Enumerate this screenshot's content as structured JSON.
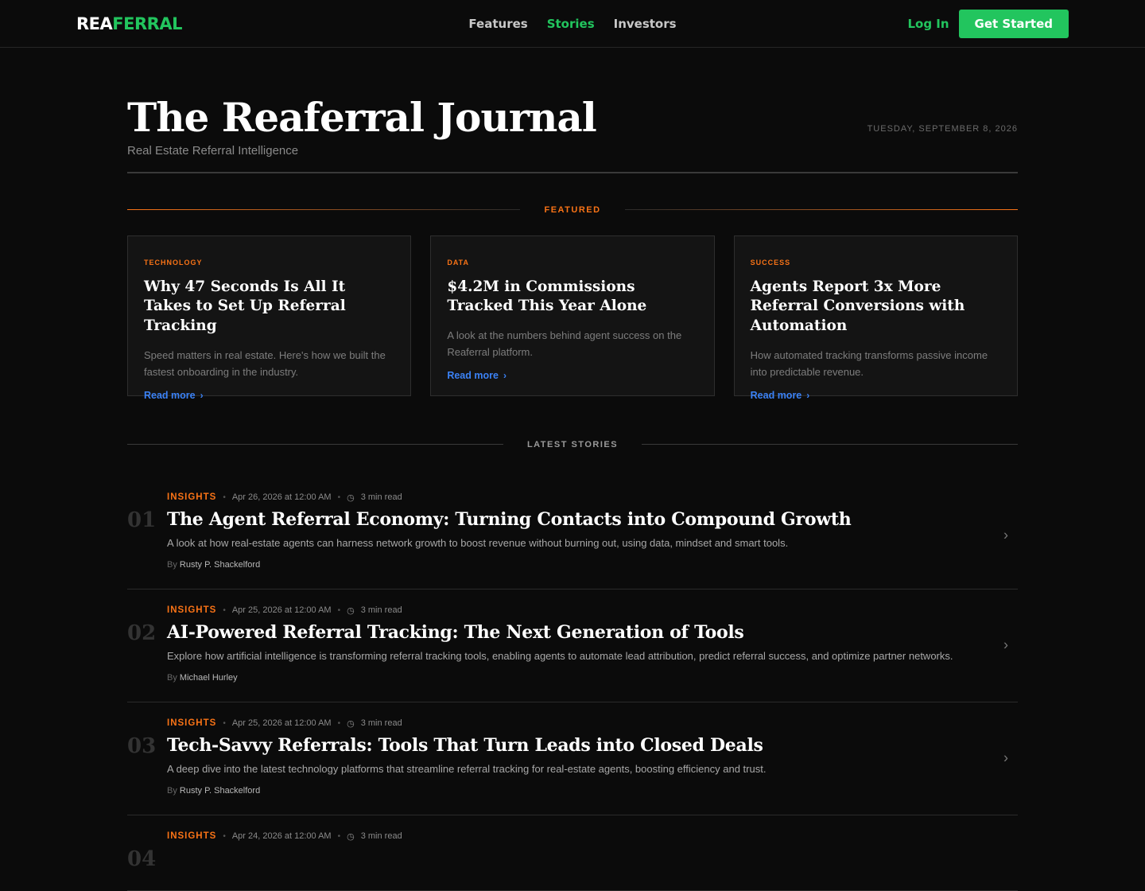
{
  "nav": {
    "logo_part1": "REA",
    "logo_part2": "FERRAL",
    "links": [
      "Features",
      "Stories",
      "Investors"
    ],
    "active_link": "Stories",
    "login": "Log In",
    "cta": "Get Started"
  },
  "masthead": {
    "title": "The Reaferral Journal",
    "subtitle": "Real Estate Referral Intelligence",
    "date": "TUESDAY, SEPTEMBER 8, 2026"
  },
  "featured": {
    "label": "FEATURED",
    "cards": [
      {
        "category": "TECHNOLOGY",
        "title": "Why 47 Seconds Is All It Takes to Set Up Referral Tracking",
        "description": "Speed matters in real estate. Here's how we built the fastest onboarding in the industry.",
        "link": "Read more"
      },
      {
        "category": "DATA",
        "title": "$4.2M in Commissions Tracked This Year Alone",
        "description": "A look at the numbers behind agent success on the Reaferral platform.",
        "link": "Read more"
      },
      {
        "category": "SUCCESS",
        "title": "Agents Report 3x More Referral Conversions with Automation",
        "description": "How automated tracking transforms passive income into predictable revenue.",
        "link": "Read more"
      }
    ]
  },
  "latest": {
    "label": "LATEST STORIES",
    "byline_prefix": "By",
    "stories": [
      {
        "number": "01",
        "category": "INSIGHTS",
        "date": "Apr 26, 2026 at 12:00 AM",
        "read_time": "3 min read",
        "title": "The Agent Referral Economy: Turning Contacts into Compound Growth",
        "description": "A look at how real-estate agents can harness network growth to boost revenue without burning out, using data, mindset and smart tools.",
        "author": "Rusty P. Shackelford"
      },
      {
        "number": "02",
        "category": "INSIGHTS",
        "date": "Apr 25, 2026 at 12:00 AM",
        "read_time": "3 min read",
        "title": "AI-Powered Referral Tracking: The Next Generation of Tools",
        "description": "Explore how artificial intelligence is transforming referral tracking tools, enabling agents to automate lead attribution, predict referral success, and optimize partner networks.",
        "author": "Michael Hurley"
      },
      {
        "number": "03",
        "category": "INSIGHTS",
        "date": "Apr 25, 2026 at 12:00 AM",
        "read_time": "3 min read",
        "title": "Tech-Savvy Referrals: Tools That Turn Leads into Closed Deals",
        "description": "A deep dive into the latest technology platforms that streamline referral tracking for real-estate agents, boosting efficiency and trust.",
        "author": "Rusty P. Shackelford"
      },
      {
        "number": "04",
        "category": "INSIGHTS",
        "date": "Apr 24, 2026 at 12:00 AM",
        "read_time": "3 min read",
        "title": "",
        "description": "",
        "author": ""
      }
    ]
  },
  "colors": {
    "accent_green": "#22c55e",
    "accent_orange": "#f97316",
    "link_blue": "#3b82f6",
    "background": "#0b0b0b"
  },
  "icons": {
    "clock": "clock-icon",
    "chevron": "chevron-right-icon"
  }
}
